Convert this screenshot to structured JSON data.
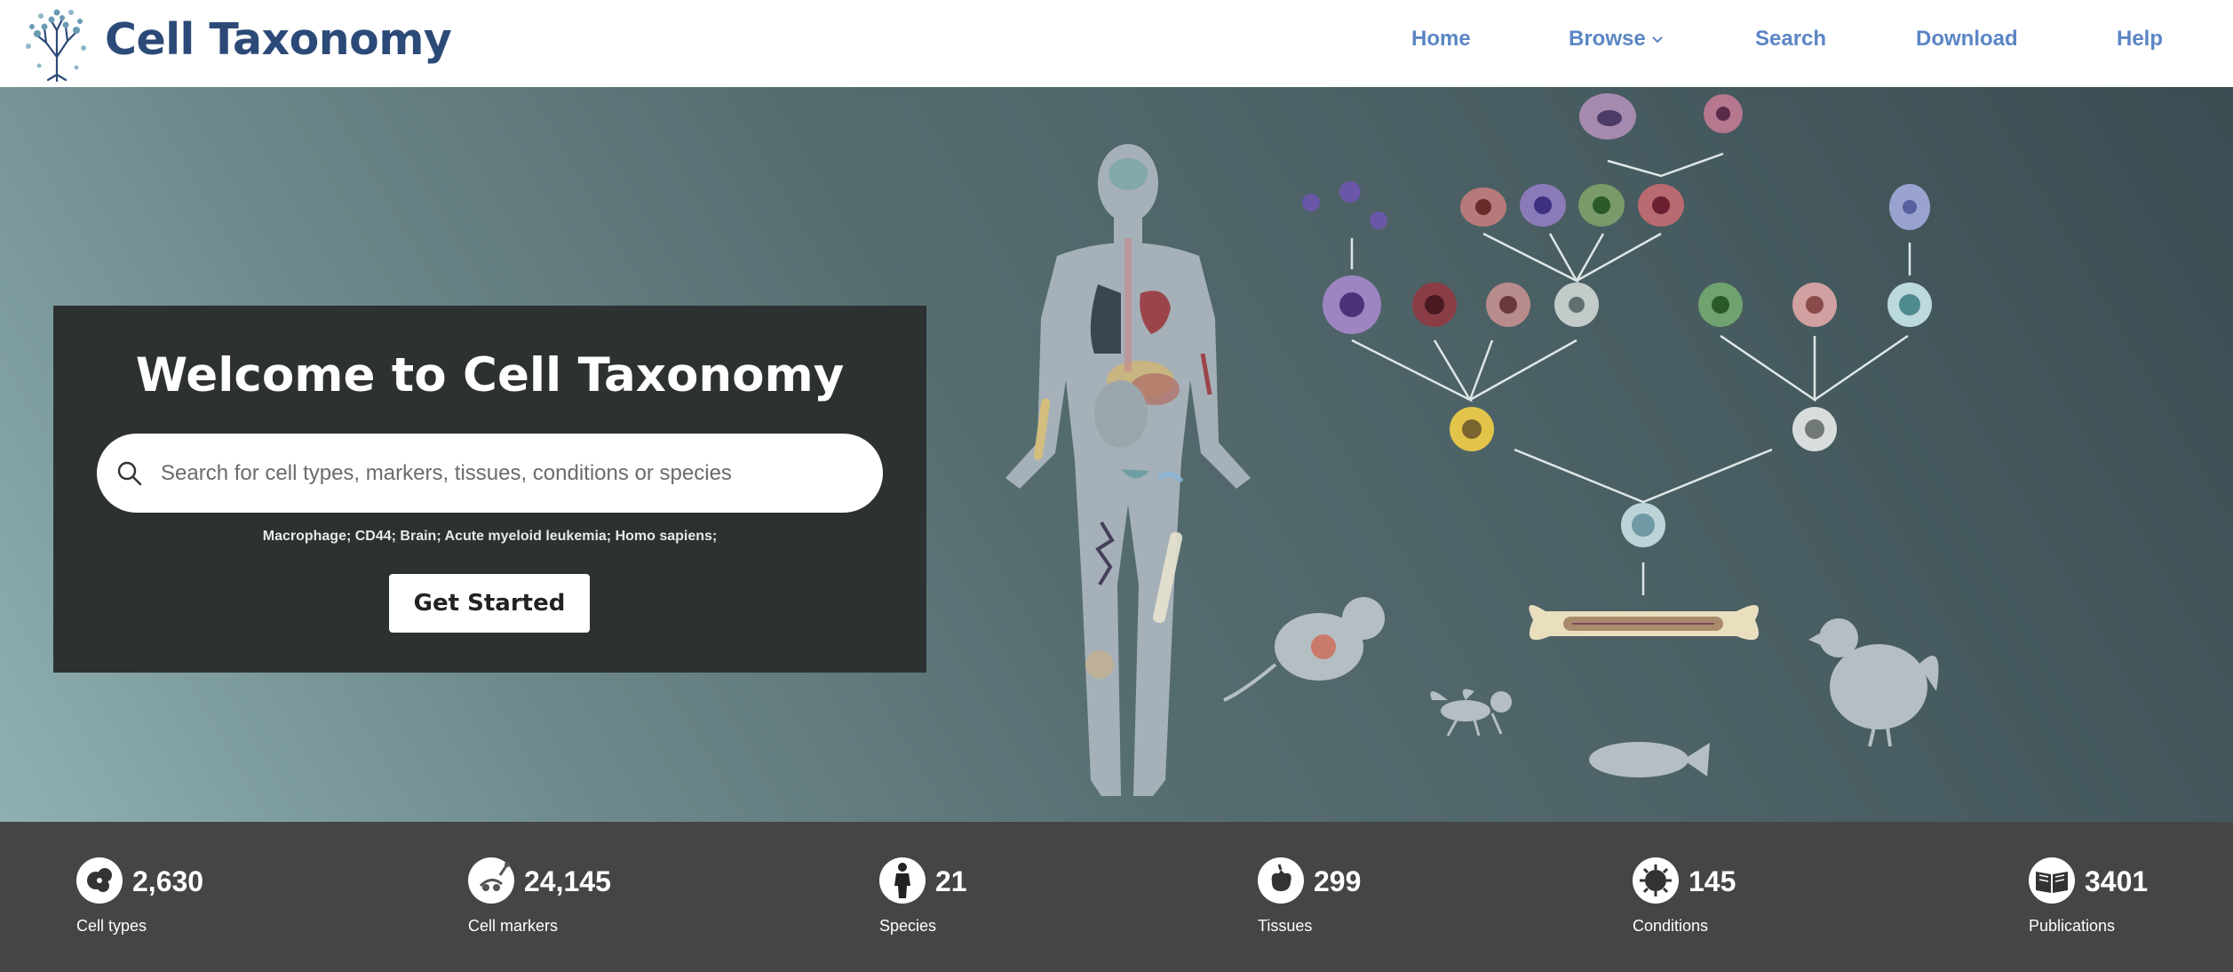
{
  "header": {
    "title": "Cell Taxonomy",
    "nav": [
      {
        "label": "Home"
      },
      {
        "label": "Browse"
      },
      {
        "label": "Search"
      },
      {
        "label": "Download"
      },
      {
        "label": "Help"
      }
    ]
  },
  "hero": {
    "welcome_title": "Welcome to Cell Taxonomy",
    "search_placeholder": "Search for cell types, markers, tissues, conditions or species",
    "examples": "Macrophage; CD44; Brain; Acute myeloid leukemia; Homo sapiens;",
    "cta_label": "Get Started"
  },
  "stats": [
    {
      "value": "2,630",
      "label": "Cell types",
      "icon": "cell-types-icon"
    },
    {
      "value": "24,145",
      "label": "Cell markers",
      "icon": "cell-markers-icon"
    },
    {
      "value": "21",
      "label": "Species",
      "icon": "species-icon"
    },
    {
      "value": "299",
      "label": "Tissues",
      "icon": "tissues-icon"
    },
    {
      "value": "145",
      "label": "Conditions",
      "icon": "conditions-icon"
    },
    {
      "value": "3401",
      "label": "Publications",
      "icon": "publications-icon"
    }
  ],
  "colors": {
    "brand": "#2c4a78",
    "nav": "#5b86c4",
    "panel": "#2d3132",
    "stats_bar": "#454545"
  }
}
